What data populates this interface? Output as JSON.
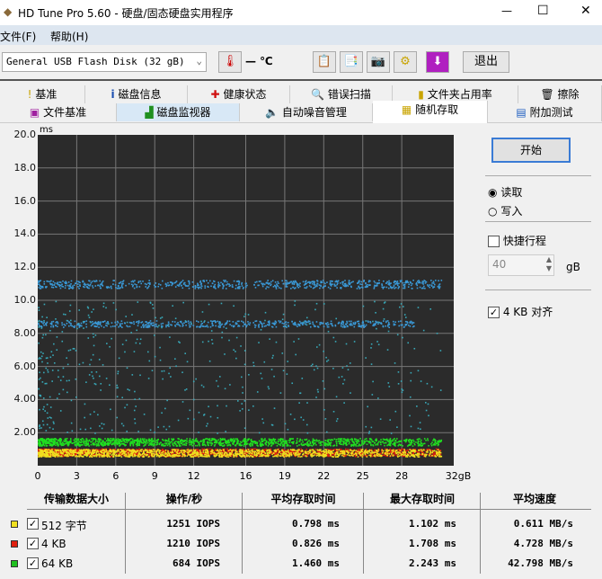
{
  "window": {
    "title": "HD Tune Pro 5.60 - 硬盘/固态硬盘实用程序",
    "min": "—",
    "max": "☐",
    "close": "✕"
  },
  "menu": [
    "文件(F)",
    "帮助(H)"
  ],
  "toolbar": {
    "drive": "General USB Flash Disk (32 gB)",
    "temp": "— ℃",
    "exit": "退出"
  },
  "tabs_row1": [
    "基准",
    "磁盘信息",
    "健康状态",
    "错误扫描",
    "文件夹占用率",
    "擦除"
  ],
  "tabs_row2": [
    "文件基准",
    "磁盘监视器",
    "自动噪音管理",
    "随机存取",
    "附加测试"
  ],
  "active_tab": "随机存取",
  "side": {
    "start": "开始",
    "read": "读取",
    "write": "写入",
    "short_stroke": "快捷行程",
    "stroke_value": "40",
    "stroke_unit": "gB",
    "align": "4 KB 对齐",
    "read_selected": true,
    "short_stroke_checked": false,
    "align_checked": true
  },
  "chart_data": {
    "type": "scatter",
    "ylabel": "ms",
    "ylim": [
      0,
      20
    ],
    "xlim": [
      0,
      32
    ],
    "yticks": [
      "20.0",
      "18.0",
      "16.0",
      "14.0",
      "12.0",
      "10.0",
      "8.00",
      "6.00",
      "4.00",
      "2.00"
    ],
    "xticks": [
      "0",
      "3",
      "6",
      "9",
      "12",
      "16",
      "19",
      "22",
      "25",
      "28",
      "32gB"
    ],
    "grid": true,
    "series": [
      {
        "name": "512 字节",
        "color": "#f0e020",
        "typical_y": 0.8
      },
      {
        "name": "4 KB",
        "color": "#e02010",
        "typical_y": 0.83
      },
      {
        "name": "64 KB",
        "color": "#20e020",
        "typical_y": 1.46
      },
      {
        "color": "#3a9ad8",
        "bands_y": [
          11.0,
          8.6
        ],
        "scatter_range": [
          2,
          10
        ]
      }
    ]
  },
  "results": {
    "headers": [
      "传输数据大小",
      "操作/秒",
      "平均存取时间",
      "最大存取时间",
      "平均速度"
    ],
    "rows": [
      {
        "size": "512 字节",
        "color": "#f0e020",
        "iops": "1251 IOPS",
        "avg": "0.798 ms",
        "max": "1.102 ms",
        "speed": "0.611 MB/s"
      },
      {
        "size": "4 KB",
        "color": "#e02010",
        "iops": "1210 IOPS",
        "avg": "0.826 ms",
        "max": "1.708 ms",
        "speed": "4.728 MB/s"
      },
      {
        "size": "64 KB",
        "color": "#20c020",
        "iops": "684 IOPS",
        "avg": "1.460 ms",
        "max": "2.243 ms",
        "speed": "42.798 MB/s"
      }
    ]
  }
}
